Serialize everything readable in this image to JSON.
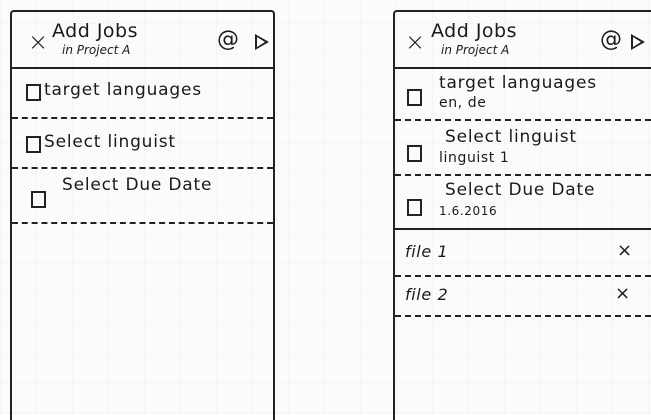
{
  "screen_before": {
    "header": {
      "title": "Add Jobs",
      "subtitle": "in Project A",
      "close_glyph": "×",
      "at_glyph": "@"
    },
    "rows": [
      {
        "label": "target languages"
      },
      {
        "label": "Select linguist"
      },
      {
        "label": "Select Due Date"
      }
    ]
  },
  "screen_after": {
    "header": {
      "title": "Add Jobs",
      "subtitle": "in Project A",
      "close_glyph": "×",
      "at_glyph": "@"
    },
    "rows": [
      {
        "label": "target languages",
        "value": "en, de"
      },
      {
        "label": "Select linguist",
        "value": "linguist 1"
      },
      {
        "label": "Select Due Date",
        "value": "1.6.2016"
      }
    ],
    "files": [
      {
        "name": "file 1",
        "remove_glyph": "×"
      },
      {
        "name": "file 2",
        "remove_glyph": "×"
      }
    ]
  }
}
